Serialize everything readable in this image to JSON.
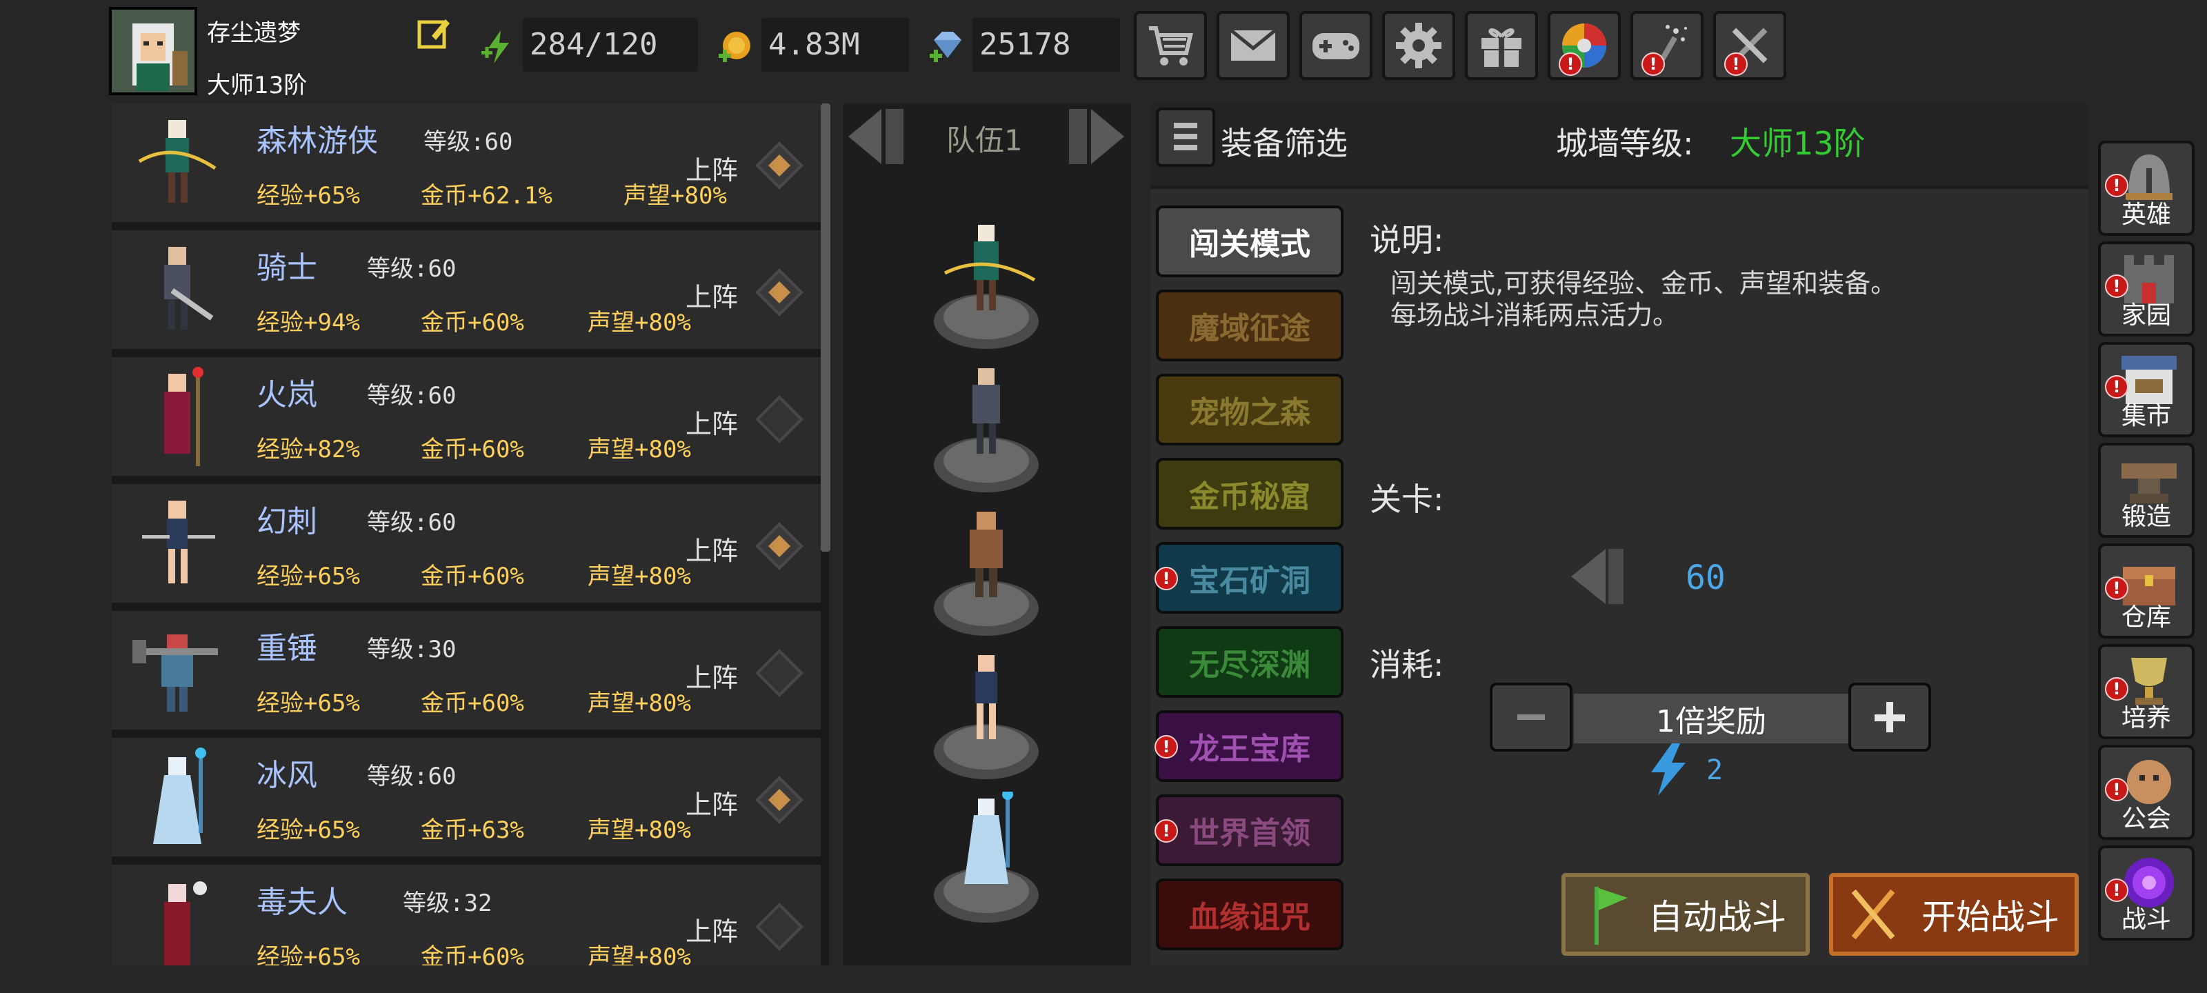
{
  "player": {
    "name": "存尘遗梦",
    "rank": "大师13阶"
  },
  "resources": {
    "energy": "284/120",
    "gold": "4.83M",
    "gems": "25178"
  },
  "top_buttons": [
    "shop-cart-icon",
    "mail-icon",
    "gamepad-icon",
    "settings-gear-icon",
    "gift-icon",
    "wheel-icon",
    "wand-icon",
    "crossed-swords-icon"
  ],
  "heroes": [
    {
      "name": "森林游侠",
      "level": "等级:60",
      "exp": "经验+65%",
      "gold": "金币+62.1%",
      "fame": "声望+80%",
      "deploy": "上阵",
      "deployed": true
    },
    {
      "name": "骑士",
      "level": "等级:60",
      "exp": "经验+94%",
      "gold": "金币+60%",
      "fame": "声望+80%",
      "deploy": "上阵",
      "deployed": true
    },
    {
      "name": "火岚",
      "level": "等级:60",
      "exp": "经验+82%",
      "gold": "金币+60%",
      "fame": "声望+80%",
      "deploy": "上阵",
      "deployed": false
    },
    {
      "name": "幻刺",
      "level": "等级:60",
      "exp": "经验+65%",
      "gold": "金币+60%",
      "fame": "声望+80%",
      "deploy": "上阵",
      "deployed": true
    },
    {
      "name": "重锤",
      "level": "等级:30",
      "exp": "经验+65%",
      "gold": "金币+60%",
      "fame": "声望+80%",
      "deploy": "上阵",
      "deployed": false
    },
    {
      "name": "冰风",
      "level": "等级:60",
      "exp": "经验+65%",
      "gold": "金币+63%",
      "fame": "声望+80%",
      "deploy": "上阵",
      "deployed": true
    },
    {
      "name": "毒夫人",
      "level": "等级:32",
      "exp": "经验+65%",
      "gold": "金币+60%",
      "fame": "声望+80%",
      "deploy": "上阵",
      "deployed": false
    }
  ],
  "team": {
    "label": "队伍1"
  },
  "filter": {
    "label": "装备筛选"
  },
  "wall": {
    "label": "城墙等级:",
    "value": "大师13阶"
  },
  "modes": [
    {
      "label": "闯关模式",
      "bg": "#4a4a4a",
      "color": "#ffffff",
      "alert": false
    },
    {
      "label": "魔域征途",
      "bg": "#4a3010",
      "color": "#8a6a30",
      "alert": false
    },
    {
      "label": "宠物之森",
      "bg": "#4a3a10",
      "color": "#8a7a30",
      "alert": false
    },
    {
      "label": "金币秘窟",
      "bg": "#3c3c10",
      "color": "#8a8a2c",
      "alert": false
    },
    {
      "label": "宝石矿洞",
      "bg": "#103a4a",
      "color": "#4a8aa0",
      "alert": true
    },
    {
      "label": "无尽深渊",
      "bg": "#103a14",
      "color": "#3a8a3a",
      "alert": false
    },
    {
      "label": "龙王宝库",
      "bg": "#3a1044",
      "color": "#a050b0",
      "alert": true
    },
    {
      "label": "世界首领",
      "bg": "#3a1a34",
      "color": "#8a4a80",
      "alert": true
    },
    {
      "label": "血缘诅咒",
      "bg": "#3a0c0c",
      "color": "#b03030",
      "alert": false
    }
  ],
  "details": {
    "desc_title": "说明:",
    "desc_line1": "闯关模式,可获得经验、金币、声望和装备。",
    "desc_line2": "每场战斗消耗两点活力。",
    "stage_label": "关卡:",
    "stage_value": "60",
    "cost_label": "消耗:",
    "multiplier": "1倍奖励",
    "energy_cost": "2"
  },
  "actions": {
    "auto": "自动战斗",
    "start": "开始战斗"
  },
  "sidebar": [
    {
      "label": "英雄",
      "icon": "helmet-icon",
      "alert": true
    },
    {
      "label": "家园",
      "icon": "castle-icon",
      "alert": true
    },
    {
      "label": "集市",
      "icon": "market-icon",
      "alert": true
    },
    {
      "label": "锻造",
      "icon": "anvil-icon",
      "alert": false
    },
    {
      "label": "仓库",
      "icon": "chest-icon",
      "alert": true
    },
    {
      "label": "培养",
      "icon": "trophy-icon",
      "alert": true
    },
    {
      "label": "公会",
      "icon": "guild-icon",
      "alert": true
    },
    {
      "label": "战斗",
      "icon": "portal-icon",
      "alert": true
    }
  ],
  "colors": {
    "hero_name": "#a9c4ff",
    "bonus": "#ffd15c",
    "wall_value": "#33cc33",
    "stage_value": "#4aa8e8"
  }
}
